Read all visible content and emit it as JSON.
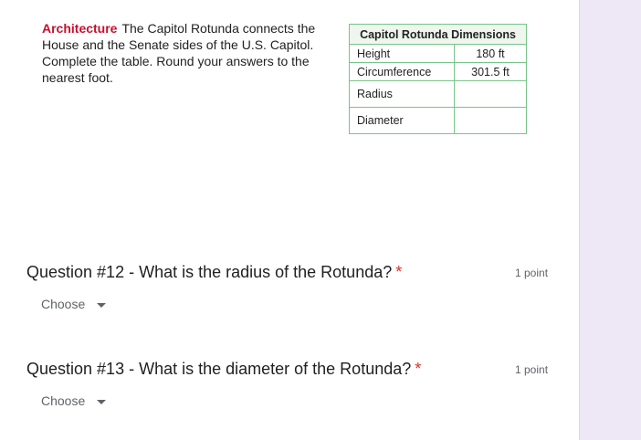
{
  "problem": {
    "keyword": "Architecture",
    "text": "The Capitol Rotunda connects the House and the Senate sides of the U.S. Capitol. Complete the table. Round your answers to the nearest foot."
  },
  "table": {
    "title": "Capitol Rotunda Dimensions",
    "rows": [
      {
        "label": "Height",
        "value": "180 ft"
      },
      {
        "label": "Circumference",
        "value": "301.5 ft"
      },
      {
        "label": "Radius",
        "value": ""
      },
      {
        "label": "Diameter",
        "value": ""
      }
    ]
  },
  "questions": [
    {
      "title": "Question #12 - What is the radius of the Rotunda?",
      "required": "*",
      "points": "1 point",
      "dropdown": "Choose"
    },
    {
      "title": "Question #13 - What is the diameter of the Rotunda?",
      "required": "*",
      "points": "1 point",
      "dropdown": "Choose"
    }
  ],
  "colors": {
    "keyword": "#c8102e",
    "table_border": "#79c48a",
    "required": "#d93025",
    "side_panel": "#ede7f6"
  },
  "icons": {
    "dropdown_caret": "caret-down-icon"
  }
}
